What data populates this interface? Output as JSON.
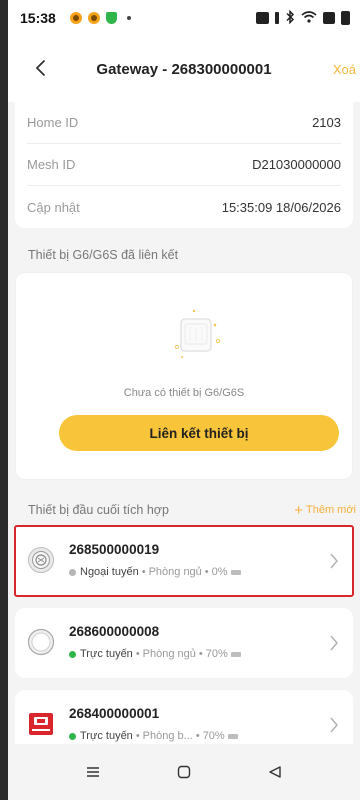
{
  "status_bar": {
    "time": "15:38"
  },
  "header": {
    "title": "Gateway - 268300000001",
    "delete_label": "Xoá",
    "back_icon": "chevron-left-icon"
  },
  "info": {
    "rows": [
      {
        "label": "Home ID",
        "value": "2103"
      },
      {
        "label": "Mesh ID",
        "value": "D21030000000"
      },
      {
        "label": "Cập nhật",
        "value": "15:35:09 18/06/2026"
      }
    ]
  },
  "linked": {
    "section_title": "Thiết bị G6/G6S đã liên kết",
    "empty_text": "Chưa có thiết bị G6/G6S",
    "link_button": "Liên kết thiết bị"
  },
  "terminals": {
    "section_title": "Thiết bị đầu cuối tích hợp",
    "add_label": "Thêm mới",
    "devices": [
      {
        "name": "268500000019",
        "status": "Ngoại tuyến",
        "room": "Phòng ngủ",
        "battery": "0%",
        "status_color": "#b5b5b5",
        "icon": "smoke-detector-icon",
        "selected": true
      },
      {
        "name": "268600000008",
        "status": "Trực tuyến",
        "room": "Phòng ngủ",
        "battery": "70%",
        "status_color": "#2fb54a",
        "icon": "round-sensor-icon",
        "selected": false
      },
      {
        "name": "268400000001",
        "status": "Trực tuyến",
        "room": "Phòng b...",
        "battery": "70%",
        "status_color": "#2fb54a",
        "icon": "fire-alarm-button-icon",
        "selected": false
      }
    ]
  },
  "colors": {
    "accent": "#f8c53a",
    "accent_text": "#f3b03a",
    "selection": "#d9262c",
    "online": "#2fb54a",
    "offline": "#b5b5b5"
  }
}
